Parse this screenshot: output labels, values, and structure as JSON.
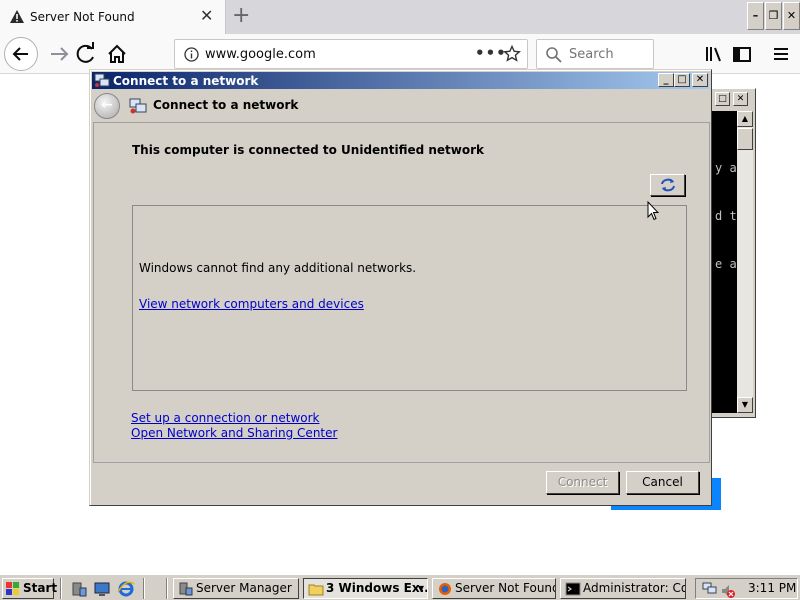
{
  "browser": {
    "tab_title": "Server Not Found",
    "url": "www.google.com",
    "search_placeholder": "Search"
  },
  "dialog": {
    "window_title": "Connect to a network",
    "header": "Connect to a network",
    "status": "This computer is connected to Unidentified network",
    "no_networks_message": "Windows cannot find any additional networks.",
    "view_devices_link": "View network computers and devices",
    "setup_link": "Set up a connection or network",
    "open_center_link": "Open Network and Sharing Center",
    "connect_label": "Connect",
    "cancel_label": "Cancel"
  },
  "console": {
    "lines": [
      "y a",
      "d t",
      "e a"
    ]
  },
  "taskbar": {
    "start_label": "Start",
    "tasks": [
      {
        "label": "Server Manager"
      },
      {
        "label": "3 Windows Ex..."
      },
      {
        "label": "Server Not Found..."
      },
      {
        "label": "Administrator: Co..."
      }
    ],
    "clock": "3:11 PM"
  }
}
